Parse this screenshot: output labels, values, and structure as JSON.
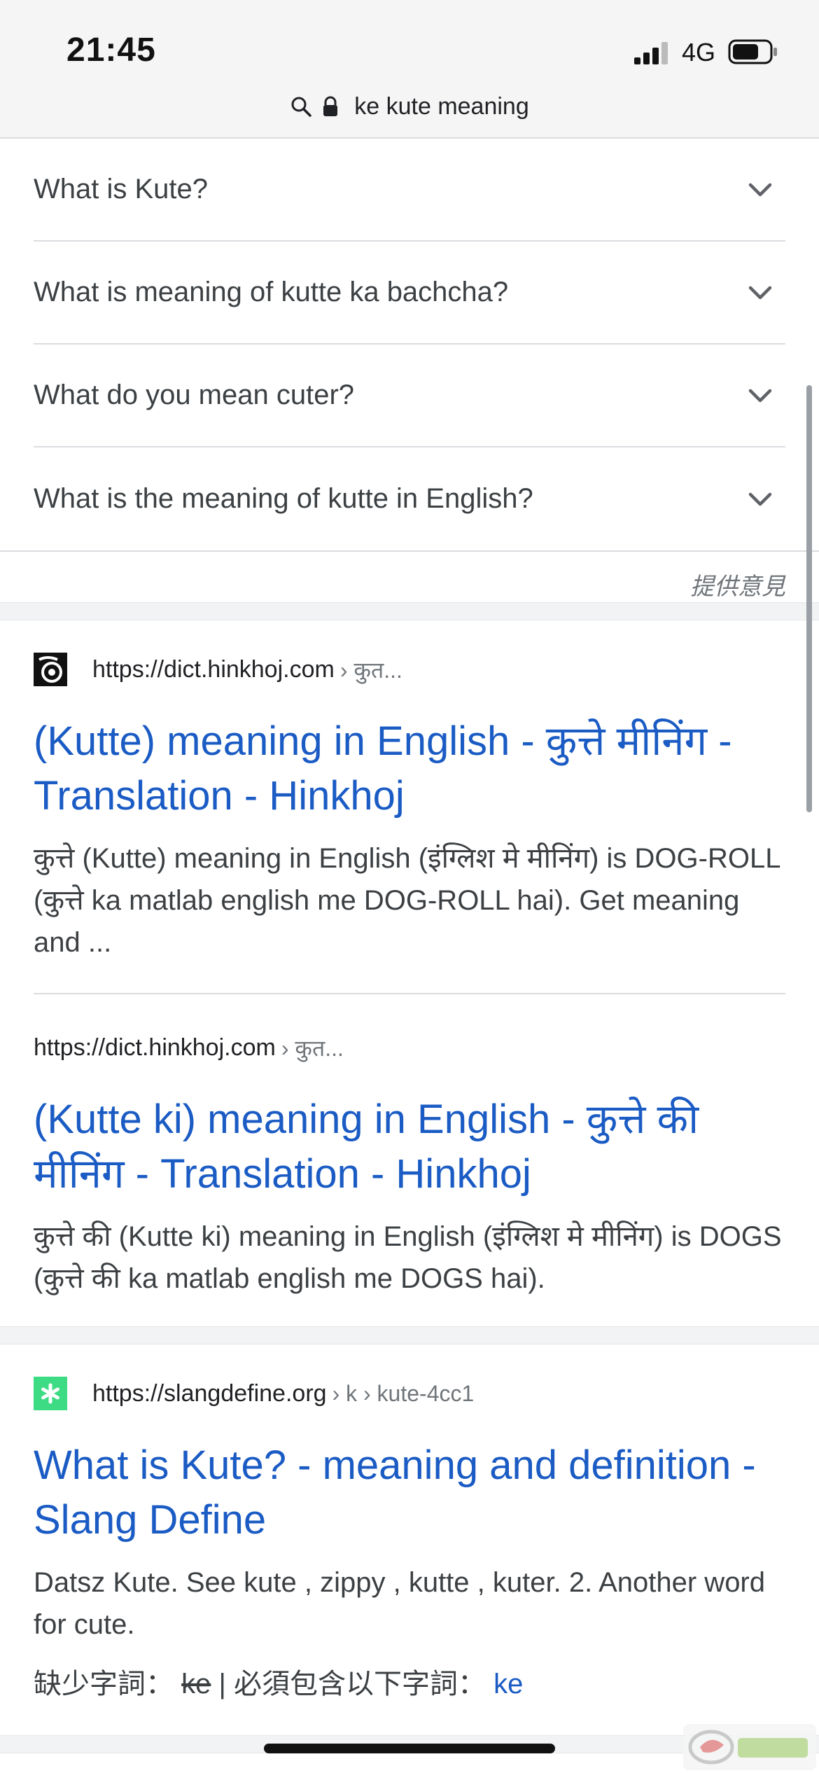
{
  "status_bar": {
    "time": "21:45",
    "network": "4G"
  },
  "address_bar": {
    "query": "ke kute meaning"
  },
  "paa": {
    "questions": [
      "What is Kute?",
      "What is meaning of kutte ka bachcha?",
      "What do you mean cuter?",
      "What is the meaning of kutte in English?"
    ],
    "feedback_label": "提供意見"
  },
  "results": [
    {
      "url": "https://dict.hinkhoj.com",
      "path": "› कुत...",
      "title": "(Kutte) meaning in English - कुत्ते मीनिंग - Translation - Hinkhoj",
      "snippet": "कुत्ते (Kutte) meaning in English (इंग्लिश मे मीनिंग) is DOG-ROLL (कुत्ते ka matlab english me DOG-ROLL hai). Get meaning and ..."
    },
    {
      "url": "https://dict.hinkhoj.com",
      "path": "› कुत...",
      "title": "(Kutte ki) meaning in English - कुत्ते की मीनिंग - Translation - Hinkhoj",
      "snippet": "कुत्ते की (Kutte ki) meaning in English (इंग्लिश मे मीनिंग) is DOGS (कुत्ते की ka matlab english me DOGS hai)."
    },
    {
      "url": "https://slangdefine.org",
      "path": "› k › kute-4cc1",
      "title": "What is Kute? - meaning and definition - Slang Define",
      "snippet": "Datsz Kute. See kute , zippy , kutte , kuter. 2. Another word for cute.",
      "missing_label": "缺少字詞：",
      "missing_word": "ke",
      "must_include_label": "| 必須包含以下字詞：",
      "must_include_word": "ke"
    }
  ],
  "colors": {
    "link": "#1a5bc4",
    "text": "#3c4043",
    "muted": "#70757a",
    "divider": "#dadce0"
  }
}
